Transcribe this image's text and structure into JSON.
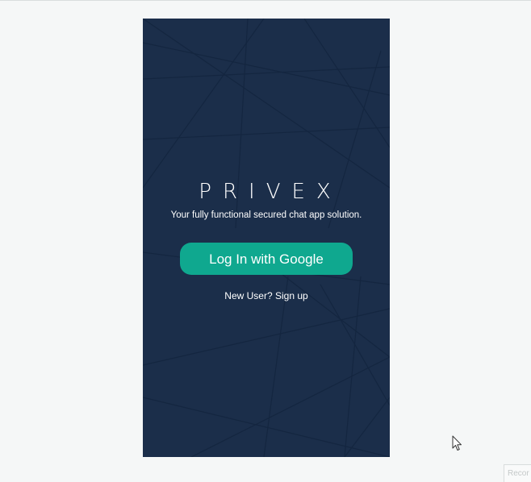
{
  "app": {
    "logo_text": "PRIVEX",
    "tagline": "Your fully functional secured chat app solution.",
    "login_button_label": "Log In with Google",
    "signup_question": "New User?",
    "signup_link_label": "Sign up"
  },
  "corner_badge": {
    "label": "Recor"
  },
  "colors": {
    "page_background": "#f5f7f7",
    "panel_background": "#1b2e4a",
    "accent": "#0fa88f",
    "text": "#ffffff"
  },
  "icons": {
    "pointer": "mouse-pointer-icon"
  }
}
